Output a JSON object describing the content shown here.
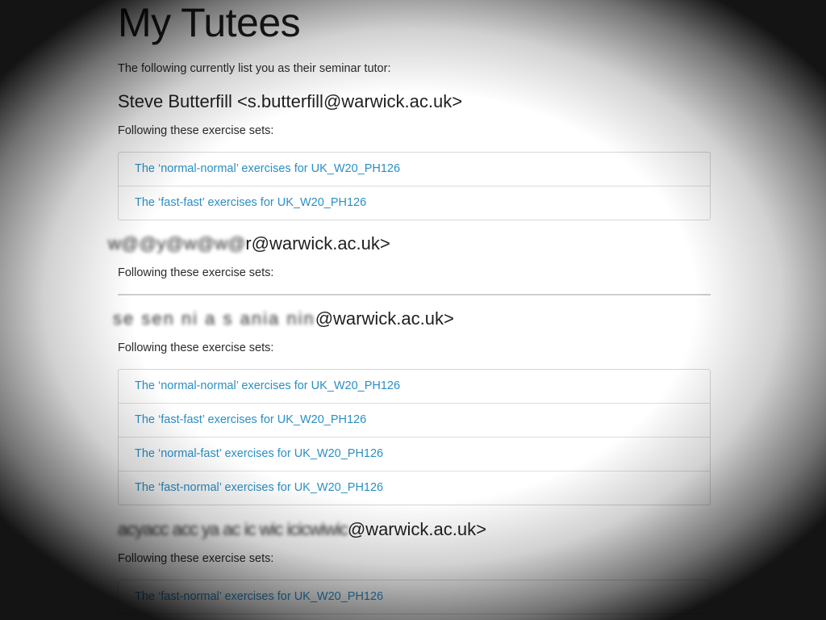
{
  "page": {
    "title": "My Tutees",
    "intro": "The following currently list you as their seminar tutor:",
    "link_color": "#2a8fc6"
  },
  "tutees": [
    {
      "name": "Steve Butterfill <s.butterfill@warwick.ac.uk>",
      "following_label": "Following these exercise sets:",
      "exercise_sets": [
        "The ‘normal-normal’ exercises for UK_W20_PH126",
        "The ‘fast-fast’ exercises for UK_W20_PH126"
      ]
    },
    {
      "name_redacted": "w@@y@w@w@",
      "name_visible": "r@warwick.ac.uk>",
      "following_label": "Following these exercise sets:",
      "exercise_sets": []
    },
    {
      "name_redacted": "se  sen ni a  s  ania nin",
      "name_visible": "@warwick.ac.uk>",
      "following_label": "Following these exercise sets:",
      "exercise_sets": [
        "The ‘normal-normal’ exercises for UK_W20_PH126",
        "The ‘fast-fast’ exercises for UK_W20_PH126",
        "The ‘normal-fast’ exercises for UK_W20_PH126",
        "The ‘fast-normal’ exercises for UK_W20_PH126"
      ]
    },
    {
      "name_redacted": "acyacc acc ya ac ic wic icicwiwic",
      "name_visible": "@warwick.ac.uk>",
      "following_label": "Following these exercise sets:",
      "exercise_sets": [
        "The ‘fast-normal’ exercises for UK_W20_PH126"
      ]
    }
  ]
}
